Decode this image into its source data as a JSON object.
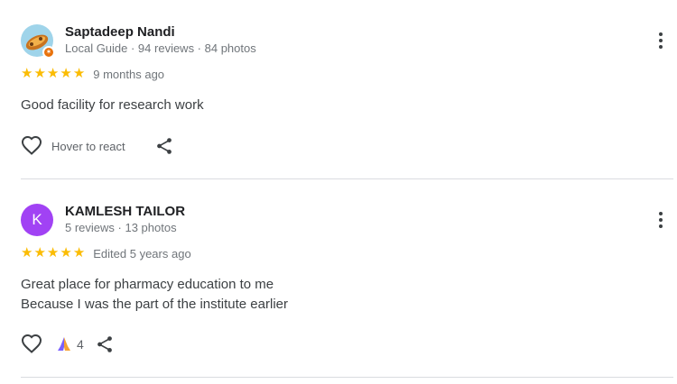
{
  "colors": {
    "star": "#fbbc04",
    "avatar_k": "#a142f4",
    "guide_badge": "#e8710a",
    "divider": "#dadce0"
  },
  "reviews": [
    {
      "name": "Saptadeep Nandi",
      "meta": "Local Guide · 94 reviews · 84 photos",
      "avatar_icon": "photo-avatar",
      "rating": 5,
      "time": "9 months ago",
      "text": [
        "Good facility for research work"
      ],
      "react_label": "Hover to react"
    },
    {
      "name": "KAMLESH TAILOR",
      "meta": "5 reviews · 13 photos",
      "avatar_letter": "K",
      "rating": 5,
      "time": "Edited 5 years ago",
      "text": [
        "Great place for pharmacy education to me",
        "Because I was the part of the institute earlier"
      ],
      "reaction_icon": "thank-you-hands-icon",
      "reaction_count": "4"
    }
  ]
}
